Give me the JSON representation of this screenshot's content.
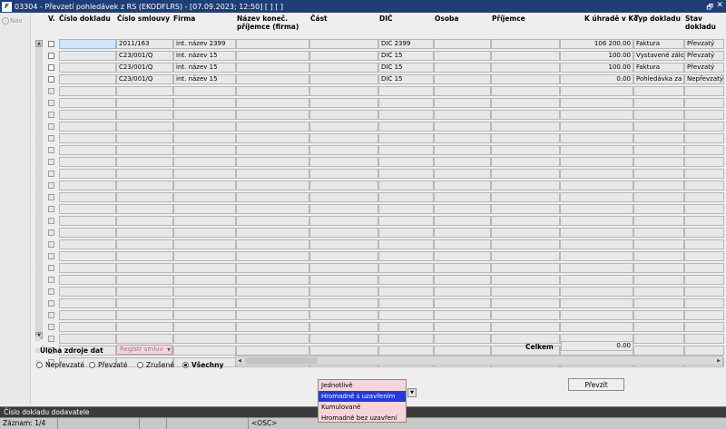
{
  "window": {
    "title": "03304 - Převzetí pohledávek z RS (EKODFLRS) - [07.09.2023; 12:50]  [ ]  [ ]",
    "restore_glyph": "🗗",
    "close_glyph": "✕"
  },
  "nav": {
    "label": "Nav"
  },
  "columns": [
    "V.",
    "Číslo dokladu",
    "Číslo smlouvy",
    "Firma",
    "Název koneč. příjemce (firma)",
    "Část",
    "DIČ",
    "Osoba",
    "Příjemce",
    "K úhradě v Kč",
    "Typ dokladu",
    "Stav dokladu"
  ],
  "rows": [
    {
      "cislo_dokladu": "",
      "cislo_smlouvy": "2011/163",
      "firma": "int. název 2399",
      "prijemce_firma": "",
      "cast": "",
      "dic": "DIČ 2399",
      "osoba": "",
      "prijemce": "",
      "k_uhrade": "106 200.00",
      "typ": "Faktura",
      "stav": "Převzatý"
    },
    {
      "cislo_dokladu": "",
      "cislo_smlouvy": "C23/001/Q",
      "firma": "int. název 15",
      "prijemce_firma": "",
      "cast": "",
      "dic": "DIČ 15",
      "osoba": "",
      "prijemce": "",
      "k_uhrade": "100.00",
      "typ": "Vystavené záloha",
      "stav": "Převzatý"
    },
    {
      "cislo_dokladu": "",
      "cislo_smlouvy": "C23/001/Q",
      "firma": "int. název 15",
      "prijemce_firma": "",
      "cast": "",
      "dic": "DIČ 15",
      "osoba": "",
      "prijemce": "",
      "k_uhrade": "100.00",
      "typ": "Faktura",
      "stav": "Převzatý"
    },
    {
      "cislo_dokladu": "",
      "cislo_smlouvy": "C23/001/Q",
      "firma": "int. název 15",
      "prijemce_firma": "",
      "cast": "",
      "dic": "DIČ 15",
      "osoba": "",
      "prijemce": "",
      "k_uhrade": "0.00",
      "typ": "Pohledávka za zaměstnancem",
      "stav": "Nepřevzatý"
    }
  ],
  "empty_row_count": 24,
  "totals": {
    "label": "Celkem",
    "value": "0.00"
  },
  "source": {
    "label": "Úloha zdroje dat",
    "value": "Registr smluv"
  },
  "filters": [
    {
      "label": "Nepřevzaté",
      "checked": false
    },
    {
      "label": "Převzaté",
      "checked": false
    },
    {
      "label": "Zrušené",
      "checked": false
    },
    {
      "label": "Všechny",
      "checked": true
    }
  ],
  "mode_dropdown": {
    "options": [
      "Jednotlivě",
      "Hromadně s uzavřením",
      "Kumulovaně",
      "Hromadně bez uzavření"
    ],
    "selected_index": 1
  },
  "actions": {
    "prevzit": "Převzít"
  },
  "status": {
    "hint": "Číslo dokladu dodavatele"
  },
  "info": {
    "record": "Záznam: 1/4",
    "mode": "<OSC>"
  },
  "colors": {
    "title_bar": "#1f3e77",
    "active_row": "#d2e4f7",
    "dropdown_bg": "#f7d4d7",
    "dropdown_selected": "#1f3be0"
  }
}
